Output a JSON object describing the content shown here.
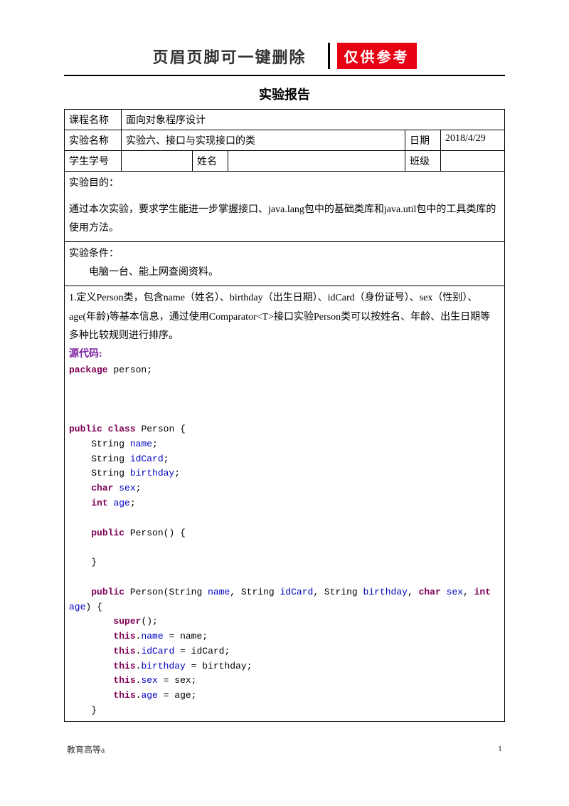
{
  "header": {
    "title": "页眉页脚可一键删除",
    "stamp": "仅供参考"
  },
  "report_title": "实验报告",
  "info": {
    "course_label": "课程名称",
    "course_value": "面向对象程序设计",
    "exp_label": "实验名称",
    "exp_value": "实验六、接口与实现接口的类",
    "date_label": "日期",
    "date_value": "2018/4/29",
    "sid_label": "学生学号",
    "sid_value": "",
    "name_label": "姓名",
    "name_value": "",
    "class_label": "班级",
    "class_value": ""
  },
  "purpose": {
    "label": "实验目的：",
    "text": "通过本次实验，要求学生能进一步掌握接口、java.lang包中的基础类库和java.util包中的工具类库的使用方法。"
  },
  "condition": {
    "label": "实验条件：",
    "text": "电脑一台、能上网查阅资料。"
  },
  "task": {
    "text": "1.定义Person类，包含name（姓名）、birthday（出生日期）、idCard（身份证号）、sex（性别）、age(年龄)等基本信息，通过使用Comparator<T>接口实验Person类可以按姓名、年龄、出生日期等多种比较规则进行排序。",
    "source_label": "源代码:"
  },
  "code": {
    "kw_package": "package",
    "pkg_name": " person;",
    "kw_public": "public",
    "kw_class": "class",
    "cls_name": " Person {",
    "line_name_type": "    String ",
    "fld_name": "name",
    "line_idcard_type": "    String ",
    "fld_idcard": "idCard",
    "line_birthday_type": "    String ",
    "fld_birthday": "birthday",
    "kw_char": "char",
    "fld_sex": "sex",
    "kw_int": "int",
    "fld_age": "age",
    "ctor1_sig": " Person() {",
    "ctor2_sig_a": " Person(String ",
    "ctor2_sig_b": ", String ",
    "ctor2_sig_c": ", String ",
    "ctor2_sig_d": ", ",
    "ctor2_sig_e": " ",
    "ctor2_sig_f": ", ",
    "ctor2_sig_g": " ",
    "ctor2_sig_h": ") {",
    "kw_super": "super",
    "kw_this": "this",
    "assign_name": " = name;",
    "assign_idcard": " = idCard;",
    "assign_birthday": " = birthday;",
    "assign_sex": " = sex;",
    "assign_age": " = age;",
    "semi": ";",
    "close": "    }",
    "close_outer": "}"
  },
  "footer": {
    "left": "教育高等a",
    "right": "1"
  }
}
